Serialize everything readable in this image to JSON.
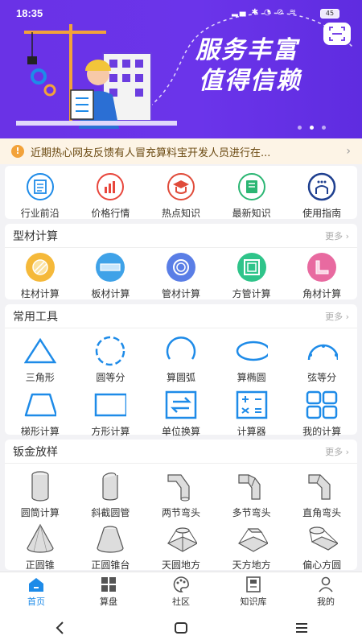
{
  "status_bar": {
    "time": "18:35",
    "battery": "45"
  },
  "banner": {
    "line1": "服务丰富",
    "line2": "值得信赖",
    "dot_count": 3,
    "active_dot": 1
  },
  "notice": {
    "text": "近期热心网友反馈有人冒充算料宝开发人员进行在..."
  },
  "quick_menu": [
    {
      "label": "行业前沿",
      "icon": "document-list-icon",
      "color": "#1e8be8"
    },
    {
      "label": "价格行情",
      "icon": "bar-chart-icon",
      "color": "#e8463c"
    },
    {
      "label": "热点知识",
      "icon": "graduation-cap-icon",
      "color": "#e04b3a"
    },
    {
      "label": "最新知识",
      "icon": "book-icon",
      "color": "#2bb673"
    },
    {
      "label": "使用指南",
      "icon": "user-guide-icon",
      "color": "#1e3f8f"
    }
  ],
  "section_profile": {
    "title": "型材计算",
    "more": "更多",
    "items": [
      {
        "label": "柱材计算",
        "icon": "round-bar-icon",
        "color": "#f5b93a"
      },
      {
        "label": "板材计算",
        "icon": "plate-icon",
        "color": "#3fa2e8"
      },
      {
        "label": "管材计算",
        "icon": "pipe-icon",
        "color": "#5a7ee6"
      },
      {
        "label": "方管计算",
        "icon": "square-tube-icon",
        "color": "#2fc48a"
      },
      {
        "label": "角材计算",
        "icon": "angle-steel-icon",
        "color": "#e86aa0"
      }
    ]
  },
  "section_tools": {
    "title": "常用工具",
    "more": "更多",
    "items": [
      {
        "label": "三角形",
        "icon": "triangle-icon"
      },
      {
        "label": "圆等分",
        "icon": "circle-divide-icon"
      },
      {
        "label": "算圆弧",
        "icon": "arc-icon"
      },
      {
        "label": "算椭圆",
        "icon": "ellipse-icon"
      },
      {
        "label": "弦等分",
        "icon": "chord-divide-icon"
      },
      {
        "label": "梯形计算",
        "icon": "trapezoid-icon"
      },
      {
        "label": "方形计算",
        "icon": "rectangle-icon"
      },
      {
        "label": "单位换算",
        "icon": "unit-convert-icon"
      },
      {
        "label": "计算器",
        "icon": "calculator-icon"
      },
      {
        "label": "我的计算",
        "icon": "grid-four-icon"
      }
    ],
    "accent": "#1e8be8"
  },
  "section_sheet": {
    "title": "钣金放样",
    "more": "更多",
    "items": [
      {
        "label": "圆筒计算",
        "icon": "cylinder-icon"
      },
      {
        "label": "斜截圆管",
        "icon": "oblique-cut-pipe-icon"
      },
      {
        "label": "两节弯头",
        "icon": "two-section-elbow-icon"
      },
      {
        "label": "多节弯头",
        "icon": "multi-section-elbow-icon"
      },
      {
        "label": "直角弯头",
        "icon": "right-angle-elbow-icon"
      },
      {
        "label": "正圆锥",
        "icon": "cone-icon"
      },
      {
        "label": "正圆锥台",
        "icon": "frustum-icon"
      },
      {
        "label": "天圆地方",
        "icon": "round-to-square-icon"
      },
      {
        "label": "天方地方",
        "icon": "square-to-square-icon"
      },
      {
        "label": "偏心方圆",
        "icon": "eccentric-transition-icon"
      }
    ]
  },
  "tabbar": [
    {
      "label": "首页",
      "icon": "home-icon",
      "active": true
    },
    {
      "label": "算盘",
      "icon": "grid-icon",
      "active": false
    },
    {
      "label": "社区",
      "icon": "palette-icon",
      "active": false
    },
    {
      "label": "知识库",
      "icon": "knowledge-book-icon",
      "active": false
    },
    {
      "label": "我的",
      "icon": "profile-icon",
      "active": false
    }
  ],
  "colors": {
    "banner": "#6a32e6",
    "accent": "#1e8be8",
    "notice_bg": "#fdf4e6"
  }
}
